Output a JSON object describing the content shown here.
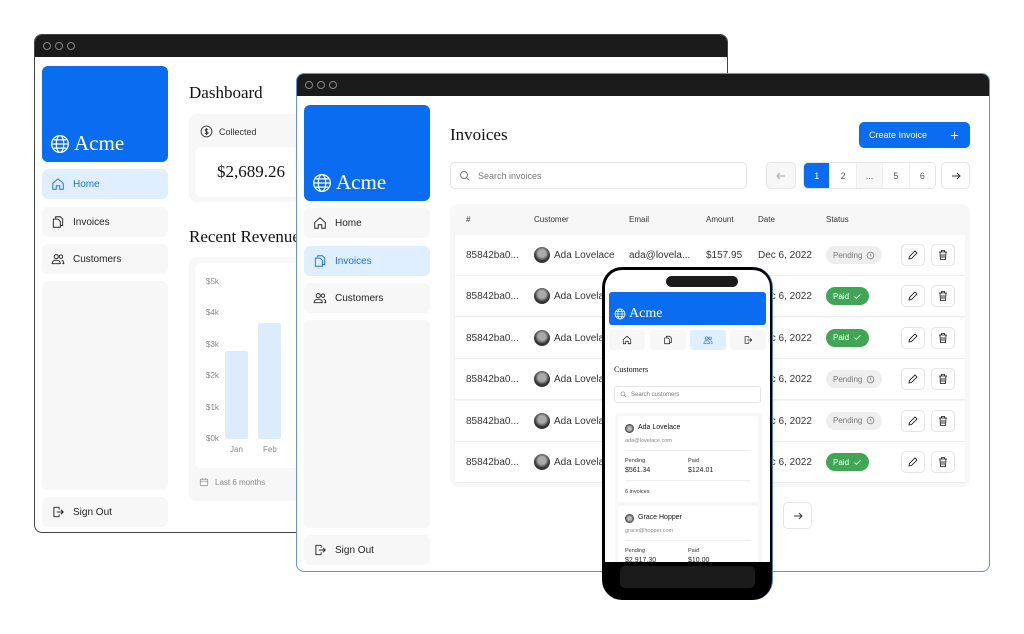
{
  "brand": "Acme",
  "colors": {
    "accent": "#0a6cf0",
    "active_nav_bg": "#e0efff",
    "paid": "#3fa656",
    "pending": "#eeeeee"
  },
  "dashboard": {
    "nav": [
      {
        "label": "Home",
        "icon": "home-icon",
        "active": true
      },
      {
        "label": "Invoices",
        "icon": "documents-icon"
      },
      {
        "label": "Customers",
        "icon": "users-icon"
      }
    ],
    "sign_out": "Sign Out",
    "title": "Dashboard",
    "collected": {
      "label": "Collected",
      "value": "$2,689.26",
      "icon": "dollar-icon"
    },
    "revenue_title": "Recent Revenue",
    "footer": "Last 6 months",
    "chart_data": {
      "type": "bar",
      "categories": [
        "Jan",
        "Feb"
      ],
      "values": [
        2800,
        3700
      ],
      "yticks": [
        "$0k",
        "$1k",
        "$2k",
        "$3k",
        "$4k",
        "$5k"
      ],
      "ylim": [
        0,
        5000
      ]
    }
  },
  "invoices": {
    "nav": [
      {
        "label": "Home",
        "icon": "home-icon"
      },
      {
        "label": "Invoices",
        "icon": "documents-icon",
        "active": true
      },
      {
        "label": "Customers",
        "icon": "users-icon"
      }
    ],
    "sign_out": "Sign Out",
    "title": "Invoices",
    "create_label": "Create Invoice",
    "search_placeholder": "Search invoices",
    "pages": [
      "1",
      "2",
      "...",
      "5",
      "6"
    ],
    "current_page": "1",
    "columns": [
      "#",
      "Customer",
      "Email",
      "Amount",
      "Date",
      "Status"
    ],
    "rows": [
      {
        "id": "85842ba0...",
        "customer": "Ada Lovelace",
        "email": "ada@lovela...",
        "amount": "$157.95",
        "date": "Dec 6, 2022",
        "status": "Pending"
      },
      {
        "id": "85842ba0...",
        "customer": "Ada Lovelace",
        "email": "",
        "amount": "",
        "date": "Dec 6, 2022",
        "status": "Paid"
      },
      {
        "id": "85842ba0...",
        "customer": "Ada Lovelace",
        "email": "",
        "amount": "",
        "date": "Dec 6, 2022",
        "status": "Paid"
      },
      {
        "id": "85842ba0...",
        "customer": "Ada Lovelace",
        "email": "",
        "amount": "",
        "date": "Dec 6, 2022",
        "status": "Pending"
      },
      {
        "id": "85842ba0...",
        "customer": "Ada Lovelace",
        "email": "",
        "amount": "",
        "date": "Dec 6, 2022",
        "status": "Pending"
      },
      {
        "id": "85842ba0...",
        "customer": "Ada Lovelace",
        "email": "",
        "amount": "",
        "date": "Dec 6, 2022",
        "status": "Paid"
      }
    ]
  },
  "mobile": {
    "title": "Customers",
    "search_placeholder": "Search customers",
    "customers": [
      {
        "name": "Ada Lovelace",
        "email": "ada@lovelace.com",
        "pending_label": "Pending",
        "pending": "$561.34",
        "paid_label": "Paid",
        "paid": "$124.01",
        "invoices": "6 invoices"
      },
      {
        "name": "Grace Hopper",
        "email": "grace@hopper.com",
        "pending_label": "Pending",
        "pending": "$2,917.30",
        "paid_label": "Paid",
        "paid": "$10.00"
      }
    ]
  }
}
